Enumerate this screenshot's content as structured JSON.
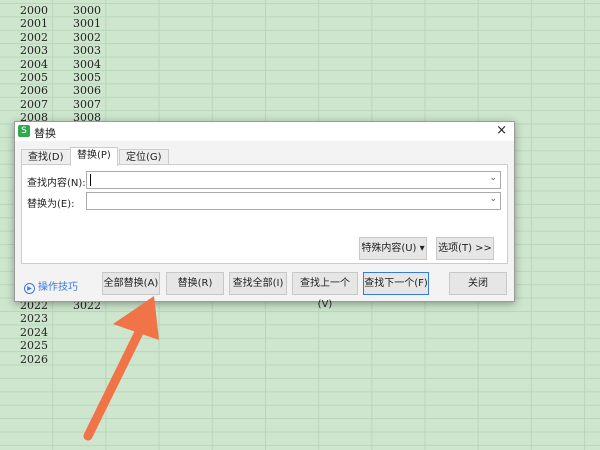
{
  "sheet": {
    "top_rows": [
      [
        "2000",
        "3000"
      ],
      [
        "2001",
        "3001"
      ],
      [
        "2002",
        "3002"
      ],
      [
        "2003",
        "3003"
      ],
      [
        "2004",
        "3004"
      ],
      [
        "2005",
        "3005"
      ],
      [
        "2006",
        "3006"
      ],
      [
        "2007",
        "3007"
      ],
      [
        "2008",
        "3008"
      ]
    ],
    "bottom_rows": [
      [
        "2022",
        "3022"
      ],
      [
        "2023",
        ""
      ],
      [
        "2024",
        ""
      ],
      [
        "2025",
        ""
      ],
      [
        "2026",
        ""
      ]
    ]
  },
  "dialog": {
    "logo": "S",
    "title": "替换",
    "close": "×",
    "tabs": [
      {
        "label": "查找(D)"
      },
      {
        "label": "替换(P)"
      },
      {
        "label": "定位(G)"
      }
    ],
    "find_label": "查找内容(N):",
    "find_value": "",
    "replace_label": "替换为(E):",
    "replace_value": "",
    "special_btn": "特殊内容(U) ▾",
    "options_btn": "选项(T) >>",
    "tips": "操作技巧",
    "buttons": [
      "全部替换(A)",
      "替换(R)",
      "查找全部(I)",
      "查找上一个(V)",
      "查找下一个(F)",
      "关闭"
    ]
  },
  "colors": {
    "arrow": "#f07448",
    "accent": "#3a7bd5"
  }
}
